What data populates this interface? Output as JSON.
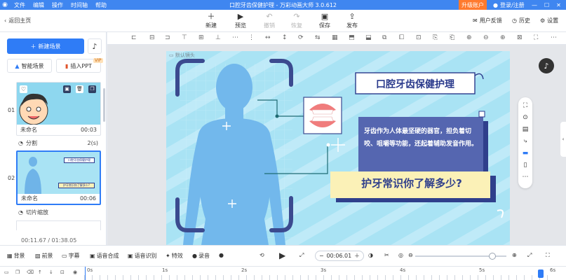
{
  "titlebar": {
    "menu": [
      "文件",
      "编辑",
      "操作",
      "时间轴",
      "帮助"
    ],
    "title": "口腔牙齿保健护理 - 万彩动画大师 3.0.612",
    "upgrade": "升级账户",
    "login": "登录/注册"
  },
  "toolbar": {
    "back": "返回主页",
    "buttons": [
      {
        "label": "新建",
        "icon": "plus-icon"
      },
      {
        "label": "预览",
        "icon": "play-icon"
      },
      {
        "label": "撤销",
        "icon": "undo-icon"
      },
      {
        "label": "恢复",
        "icon": "redo-icon"
      },
      {
        "label": "保存",
        "icon": "save-icon"
      },
      {
        "label": "发布",
        "icon": "publish-icon"
      }
    ],
    "feedback": "用户反馈",
    "history": "历史",
    "settings": "设置"
  },
  "left": {
    "new_scene": "新建场景",
    "smart_scene": "智能场景",
    "insert_ppt": "插入PPT",
    "vip": "VIP",
    "scenes": [
      {
        "num": "01",
        "name": "未命名",
        "time": "00:03"
      },
      {
        "num": "02",
        "name": "未命名",
        "time": "00:06"
      }
    ],
    "transitions": [
      {
        "name": "分割",
        "dur": "2(s)"
      },
      {
        "name": "切片缩放",
        "dur": "2(s)"
      }
    ],
    "time_readout": "00:11.67  / 01:38.05"
  },
  "stage": {
    "label": "默认镜头",
    "title": "口腔牙齿保健护理",
    "body": "牙齿作为人体最坚硬的器官，担负着切咬、咀嚼等功能，还起着辅助发音作用。",
    "question": "护牙常识你了解多少?",
    "thumb_title": "口腔牙齿保健护理",
    "thumb_question": "护牙常识你了解多少?"
  },
  "bottom": {
    "buttons": [
      "背景",
      "前景",
      "字幕",
      "语音合成",
      "语音识别",
      "特效",
      "录音"
    ],
    "time": "00:06.01"
  },
  "timeline": {
    "ticks": [
      "0s",
      "1s",
      "2s",
      "3s",
      "4s",
      "5s",
      "6s"
    ]
  },
  "colors": {
    "accent": "#2f7cf6",
    "stage_bg": "#a9e3f4",
    "title_navy": "#2a3a8c"
  }
}
